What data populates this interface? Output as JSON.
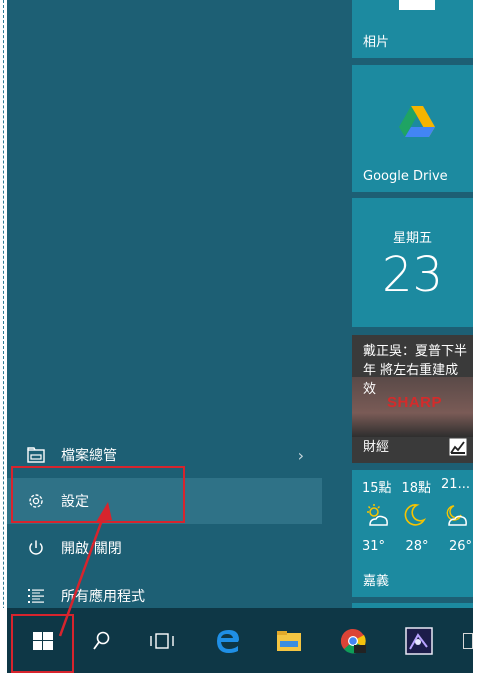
{
  "start_menu": {
    "items": [
      {
        "label": "檔案總管",
        "icon": "file-explorer-icon",
        "has_submenu": true
      },
      {
        "label": "設定",
        "icon": "gear-icon",
        "highlighted": true
      },
      {
        "label": "開啟/關閉",
        "icon": "power-icon"
      },
      {
        "label": "所有應用程式",
        "icon": "all-apps-icon"
      }
    ]
  },
  "tiles": {
    "photos": {
      "label": "相片"
    },
    "google_drive": {
      "label": "Google Drive"
    },
    "calendar": {
      "day_name": "星期五",
      "day_number": "23"
    },
    "finance": {
      "headline": "戴正吳：夏普下半年 將左右重建成效",
      "label": "財經",
      "brand_watermark": "SHARP"
    },
    "weather": {
      "hours": [
        "15點",
        "18點",
        "21..."
      ],
      "temps": [
        "31°",
        "28°",
        "26°"
      ],
      "location": "嘉義"
    }
  },
  "taskbar": {
    "apps": [
      "windows-start-icon",
      "search-icon",
      "task-view-icon",
      "edge-icon",
      "file-explorer-icon",
      "chrome-icon",
      "app-icon"
    ]
  },
  "colors": {
    "menu_bg": "#1d5f74",
    "tile_bg": "#1c8aa0",
    "taskbar_bg": "#0e3746",
    "annotation_red": "#d7242d"
  }
}
